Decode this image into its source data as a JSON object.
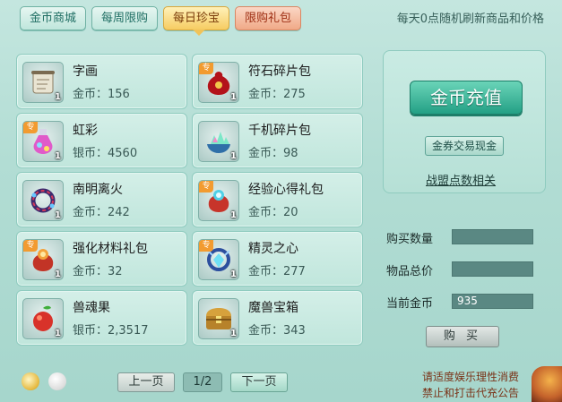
{
  "tabs": [
    {
      "label": "金币商城"
    },
    {
      "label": "每周限购"
    },
    {
      "label": "每日珍宝"
    },
    {
      "label": "限购礼包"
    }
  ],
  "notice": "每天0点随机刷新商品和价格",
  "items": [
    {
      "name": "字画",
      "price": "金币：156",
      "qty": "1",
      "tag": "",
      "icon": "scroll-icon"
    },
    {
      "name": "符石碎片包",
      "price": "金币：275",
      "qty": "1",
      "tag": "专",
      "icon": "rune-bag-icon"
    },
    {
      "name": "虹彩",
      "price": "银币：4560",
      "qty": "1",
      "tag": "专",
      "icon": "potion-icon"
    },
    {
      "name": "千机碎片包",
      "price": "金币：98",
      "qty": "1",
      "tag": "",
      "icon": "crystal-bowl-icon"
    },
    {
      "name": "南明离火",
      "price": "金币：242",
      "qty": "1",
      "tag": "",
      "icon": "fire-ring-icon"
    },
    {
      "name": "经验心得礼包",
      "price": "金币：20",
      "qty": "1",
      "tag": "专",
      "icon": "exp-bag-icon"
    },
    {
      "name": "强化材料礼包",
      "price": "金币：32",
      "qty": "1",
      "tag": "专",
      "icon": "material-bag-icon"
    },
    {
      "name": "精灵之心",
      "price": "金币：277",
      "qty": "1",
      "tag": "专",
      "icon": "spirit-heart-icon"
    },
    {
      "name": "兽魂果",
      "price": "银币：2,3517",
      "qty": "1",
      "tag": "",
      "icon": "fruit-icon"
    },
    {
      "name": "魔兽宝箱",
      "price": "金币：343",
      "qty": "1",
      "tag": "",
      "icon": "treasure-chest-icon"
    }
  ],
  "pager": {
    "prev": "上一页",
    "page": "1/2",
    "next": "下一页"
  },
  "right": {
    "charge": "金币充值",
    "exchange": "金券交易现金",
    "alliance": "战盟点数相关",
    "qty_label": "购买数量",
    "qty_value": "",
    "total_label": "物品总价",
    "total_value": "",
    "gold_label": "当前金币",
    "gold_value": "935",
    "buy": "购 买"
  },
  "warnings": [
    "请适度娱乐理性消费",
    "禁止和打击代充公告"
  ]
}
